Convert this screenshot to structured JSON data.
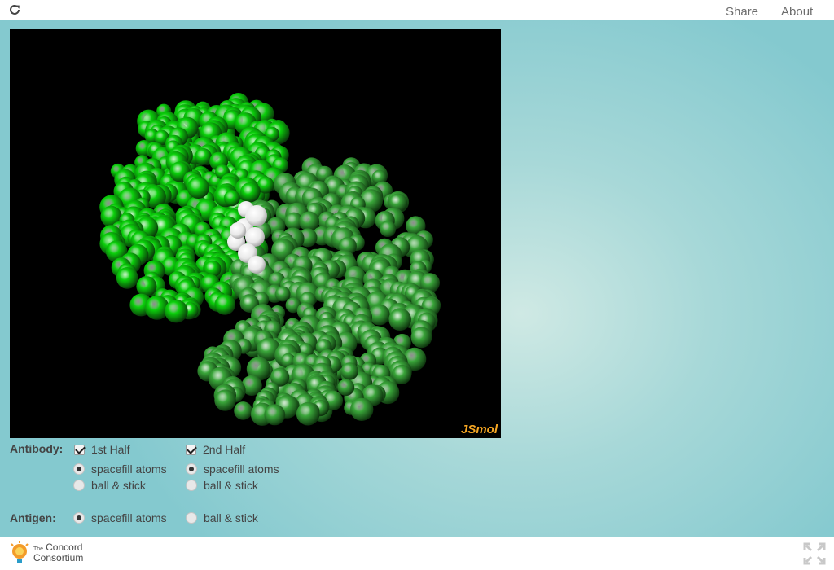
{
  "topbar": {
    "share_label": "Share",
    "about_label": "About"
  },
  "viewer": {
    "watermark": "JSmol",
    "colors": {
      "background": "#000000",
      "antibody_half1": "#0bd10b",
      "antibody_half2": "#3aa63a",
      "antigen": "#e8e8e8",
      "watermark": "#f5a623"
    }
  },
  "controls": {
    "antibody_label": "Antibody:",
    "antigen_label": "Antigen:",
    "half1": {
      "label": "1st Half",
      "checked": true
    },
    "half2": {
      "label": "2nd Half",
      "checked": true
    },
    "half1_spacefill": {
      "label": "spacefill atoms",
      "selected": true
    },
    "half1_ballstick": {
      "label": "ball & stick",
      "selected": false
    },
    "half2_spacefill": {
      "label": "spacefill atoms",
      "selected": true
    },
    "half2_ballstick": {
      "label": "ball & stick",
      "selected": false
    },
    "antigen_spacefill": {
      "label": "spacefill atoms",
      "selected": true
    },
    "antigen_ballstick": {
      "label": "ball & stick",
      "selected": false
    }
  },
  "footer": {
    "logo_line1": "The",
    "logo_line1b": "Concord",
    "logo_line2": "Consortium"
  }
}
